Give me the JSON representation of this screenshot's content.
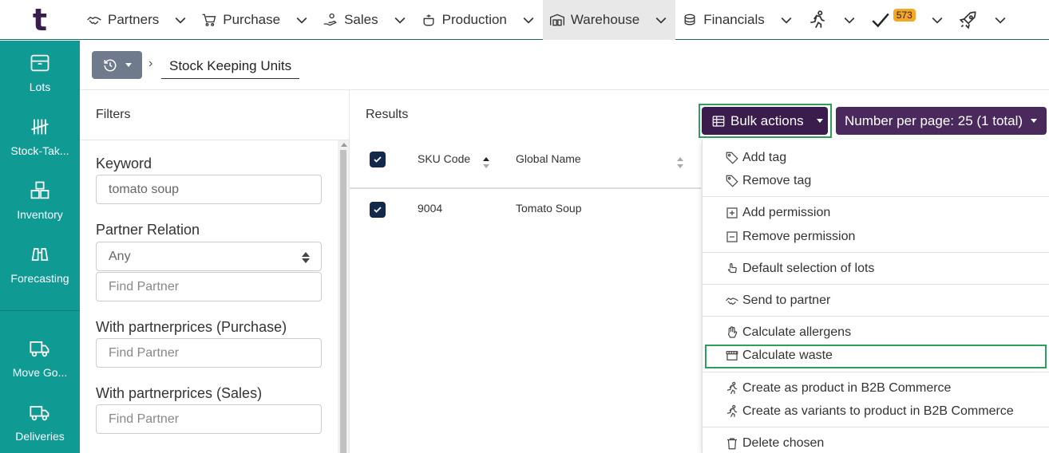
{
  "app": {
    "logo": "t"
  },
  "nav": {
    "items": [
      {
        "label": "Partners",
        "icon": "handshake-icon"
      },
      {
        "label": "Purchase",
        "icon": "cart-icon"
      },
      {
        "label": "Sales",
        "icon": "hand-coins-icon"
      },
      {
        "label": "Production",
        "icon": "pot-icon"
      },
      {
        "label": "Warehouse",
        "icon": "warehouse-icon",
        "active": true
      },
      {
        "label": "Financials",
        "icon": "coins-icon"
      }
    ],
    "badge_count": "573"
  },
  "sidebar": {
    "items": [
      {
        "label": "Lots",
        "icon": "box-icon"
      },
      {
        "label": "Stock-Tak...",
        "icon": "tally-icon"
      },
      {
        "label": "Inventory",
        "icon": "boxes-icon"
      },
      {
        "label": "Forecasting",
        "icon": "binoculars-icon"
      },
      {
        "label": "Move Go...",
        "icon": "moving-truck-icon"
      },
      {
        "label": "Deliveries",
        "icon": "truck-icon"
      }
    ]
  },
  "breadcrumb": {
    "current": "Stock Keeping Units"
  },
  "filters": {
    "title": "Filters",
    "keyword_label": "Keyword",
    "keyword_value": "tomato soup",
    "partner_relation_label": "Partner Relation",
    "partner_relation_value": "Any",
    "find_partner_placeholder": "Find Partner",
    "purchase_label": "With partnerprices (Purchase)",
    "sales_label": "With partnerprices (Sales)"
  },
  "results": {
    "title": "Results",
    "bulk_actions_label": "Bulk actions",
    "number_per_page_label": "Number per page: 25 (1 total)",
    "columns": [
      "SKU Code",
      "Global Name"
    ],
    "rows": [
      {
        "sku": "9004",
        "name": "Tomato Soup",
        "checked": true
      }
    ]
  },
  "bulk_menu": {
    "items": [
      "Add tag",
      "Remove tag",
      "Add permission",
      "Remove permission",
      "Default selection of lots",
      "Send to partner",
      "Calculate allergens",
      "Calculate waste",
      "Create as product in B2B Commerce",
      "Create as variants to product in B2B Commerce",
      "Delete chosen"
    ],
    "highlighted": "Calculate waste"
  }
}
